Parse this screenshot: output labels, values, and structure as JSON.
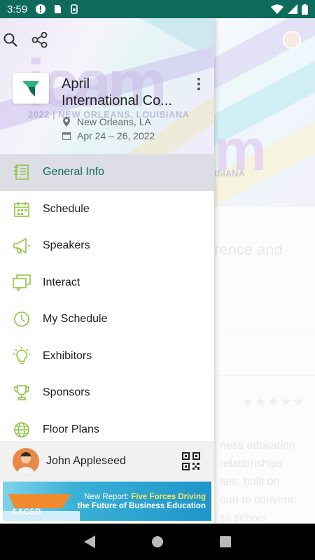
{
  "status_bar": {
    "time": "3:59"
  },
  "drawer": {
    "header": {
      "logo_text": "icam",
      "logo_subtitle": "2022 | NEW ORLEANS, LOUISIANA",
      "event_title_line1": "April",
      "event_title_line2": "International Co...",
      "location": "New Orleans, LA",
      "dates": "Apr 24 – 26, 2022"
    },
    "menu": [
      {
        "label": "General Info",
        "icon": "document-list-icon",
        "active": true
      },
      {
        "label": "Schedule",
        "icon": "calendar-icon",
        "active": false
      },
      {
        "label": "Speakers",
        "icon": "megaphone-icon",
        "active": false
      },
      {
        "label": "Interact",
        "icon": "chat-bubble-icon",
        "active": false
      },
      {
        "label": "My Schedule",
        "icon": "clock-icon",
        "active": false
      },
      {
        "label": "Exhibitors",
        "icon": "lightbulb-icon",
        "active": false
      },
      {
        "label": "Sponsors",
        "icon": "trophy-icon",
        "active": false
      },
      {
        "label": "Floor Plans",
        "icon": "globe-icon",
        "active": false
      }
    ],
    "profile": {
      "name": "John Appleseed"
    },
    "banner": {
      "brand": "AACSB",
      "prefix": "New Report: ",
      "highlight": "Five Forces Driving",
      "line2": "the Future of Business Education"
    }
  },
  "background": {
    "logo_text": "m",
    "subtitle": "ISIANA",
    "heading": "rence and",
    "body_lines": [
      "ness education",
      "relationships",
      "ties, built on",
      "oud to convene",
      "ss school"
    ]
  },
  "colors": {
    "primary": "#0e6b5b",
    "icon_green": "#8cc63f",
    "active_bg": "#dddde6"
  }
}
